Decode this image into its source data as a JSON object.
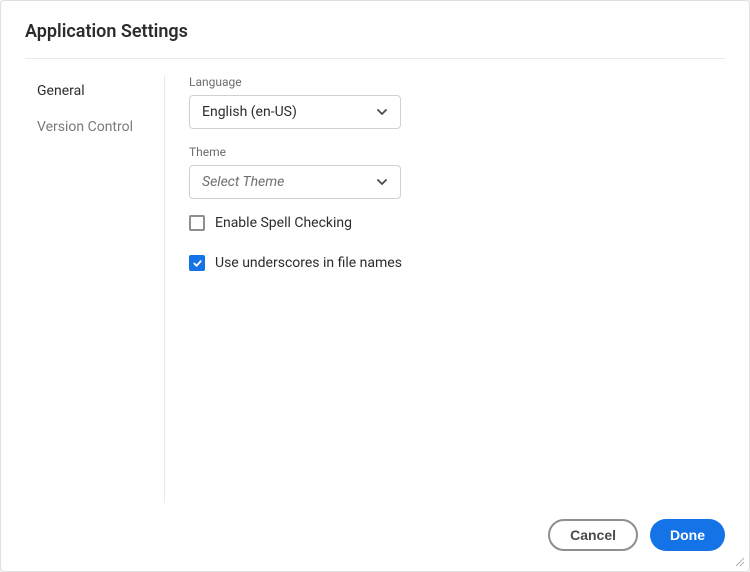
{
  "title": "Application Settings",
  "sidebar": {
    "items": [
      {
        "label": "General",
        "active": true
      },
      {
        "label": "Version Control",
        "active": false
      }
    ]
  },
  "panel": {
    "language": {
      "label": "Language",
      "value": "English (en-US)"
    },
    "theme": {
      "label": "Theme",
      "placeholder": "Select Theme"
    },
    "spellcheck": {
      "label": "Enable Spell Checking",
      "checked": false
    },
    "underscores": {
      "label": "Use underscores in file names",
      "checked": true
    }
  },
  "footer": {
    "cancel": "Cancel",
    "done": "Done"
  }
}
